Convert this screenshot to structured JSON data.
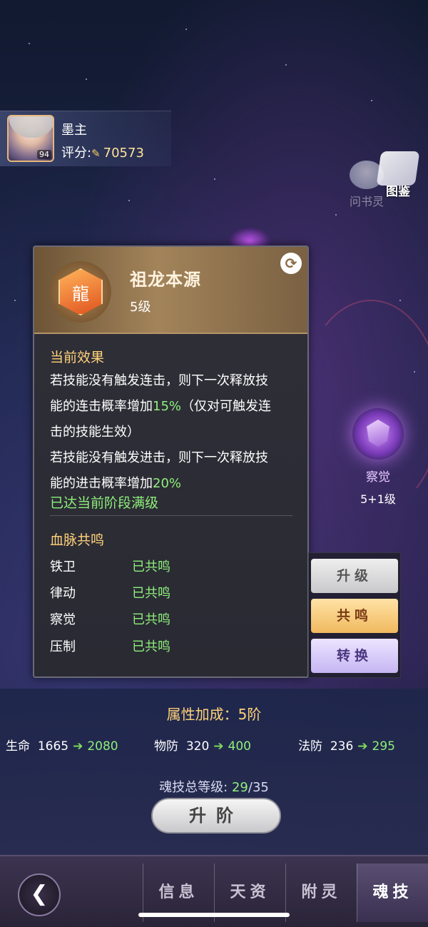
{
  "player": {
    "name": "墨主",
    "level": "94",
    "score_label": "评分:",
    "score_value": "70573"
  },
  "top_icons": {
    "book_spirit": "问书灵",
    "codex": "图鉴"
  },
  "right_node": {
    "label": "察觉",
    "level": "5+1级"
  },
  "popup": {
    "skill_name": "祖龙本源",
    "skill_level": "5级",
    "current_effect_title": "当前效果",
    "effect_line1_a": "若技能没有触发连击，则下一次释放技",
    "effect_line2_a": "能的连击概率增加",
    "effect_line2_hl": "15%",
    "effect_line2_b": "（仅对可触发连",
    "effect_line3": "击的技能生效）",
    "effect_line4": "若技能没有触发进击，则下一次释放技",
    "effect_line5_a": "能的进击概率增加",
    "effect_line5_hl": "20%",
    "maxed_text": "已达当前阶段满级",
    "bloodline_title": "血脉共鸣",
    "resonances": [
      {
        "name": "铁卫",
        "status": "已共鸣"
      },
      {
        "name": "律动",
        "status": "已共鸣"
      },
      {
        "name": "察觉",
        "status": "已共鸣"
      },
      {
        "name": "压制",
        "status": "已共鸣"
      }
    ]
  },
  "side_buttons": {
    "upgrade": "升级",
    "resonate": "共鸣",
    "convert": "转换"
  },
  "stats": {
    "title": "属性加成：5阶",
    "items": [
      {
        "name": "生命",
        "old": "1665",
        "new": "2080"
      },
      {
        "name": "物防",
        "old": "320",
        "new": "400"
      },
      {
        "name": "法防",
        "old": "236",
        "new": "295"
      }
    ],
    "total_label": "魂技总等级:",
    "total_current": "29",
    "total_max": "/35",
    "advance_button": "升阶"
  },
  "nav": {
    "tabs": [
      "信息",
      "天资",
      "附灵",
      "魂技"
    ],
    "active": "魂技"
  },
  "colors": {
    "highlight_green": "#8ef07b",
    "gold_title": "#ffd27a"
  }
}
